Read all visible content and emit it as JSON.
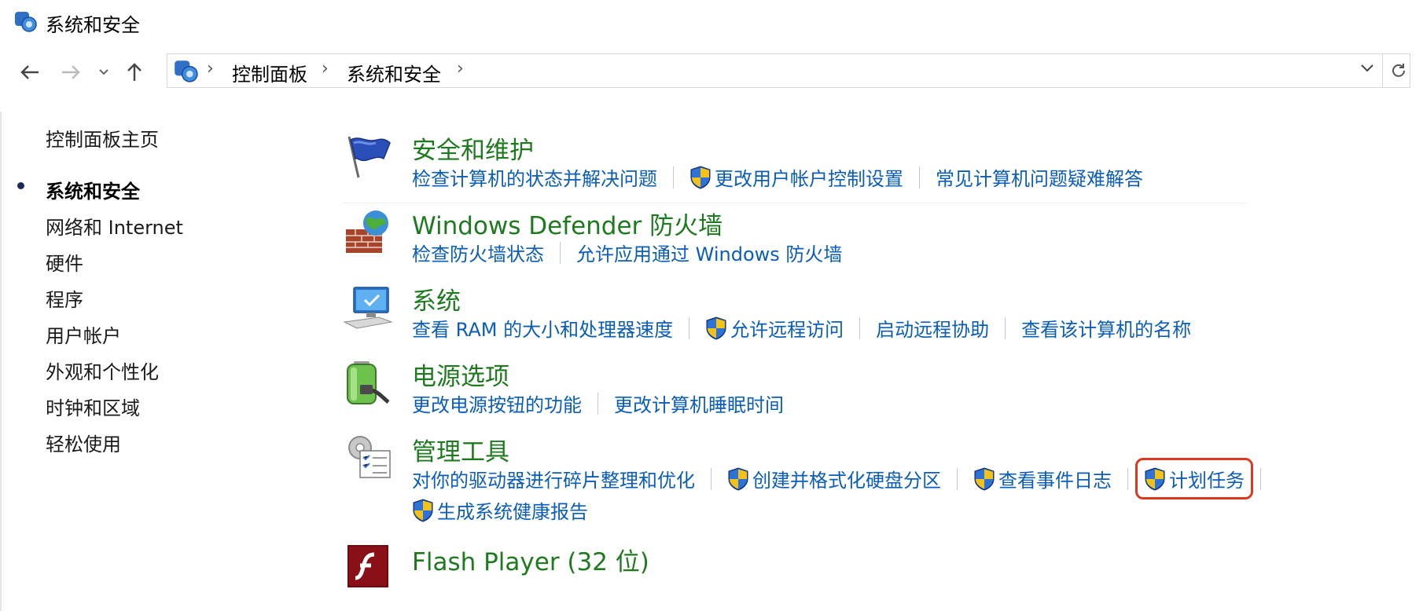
{
  "window": {
    "title": "系统和安全"
  },
  "address_bar": {
    "breadcrumbs": [
      "控制面板",
      "系统和安全"
    ]
  },
  "left_nav": {
    "items": [
      {
        "label": "控制面板主页",
        "active": false
      },
      {
        "label": "系统和安全",
        "active": true
      },
      {
        "label": "网络和 Internet",
        "active": false
      },
      {
        "label": "硬件",
        "active": false
      },
      {
        "label": "程序",
        "active": false
      },
      {
        "label": "用户帐户",
        "active": false
      },
      {
        "label": "外观和个性化",
        "active": false
      },
      {
        "label": "时钟和区域",
        "active": false
      },
      {
        "label": "轻松使用",
        "active": false
      }
    ]
  },
  "categories": [
    {
      "title": "安全和维护",
      "icon": "flag-icon",
      "links": [
        {
          "label": "检查计算机的状态并解决问题",
          "shield": false
        },
        {
          "label": "更改用户帐户控制设置",
          "shield": true
        },
        {
          "label": "常见计算机问题疑难解答",
          "shield": false
        }
      ]
    },
    {
      "title": "Windows Defender 防火墙",
      "icon": "firewall-icon",
      "links": [
        {
          "label": "检查防火墙状态",
          "shield": false
        },
        {
          "label": "允许应用通过 Windows 防火墙",
          "shield": false
        }
      ]
    },
    {
      "title": "系统",
      "icon": "computer-icon",
      "links": [
        {
          "label": "查看 RAM 的大小和处理器速度",
          "shield": false
        },
        {
          "label": "允许远程访问",
          "shield": true
        },
        {
          "label": "启动远程协助",
          "shield": false
        },
        {
          "label": "查看该计算机的名称",
          "shield": false
        }
      ]
    },
    {
      "title": "电源选项",
      "icon": "battery-icon",
      "links": [
        {
          "label": "更改电源按钮的功能",
          "shield": false
        },
        {
          "label": "更改计算机睡眠时间",
          "shield": false
        }
      ]
    },
    {
      "title": "管理工具",
      "icon": "admin-tools-icon",
      "links": [
        {
          "label": "对你的驱动器进行碎片整理和优化",
          "shield": false
        },
        {
          "label": "创建并格式化硬盘分区",
          "shield": true
        },
        {
          "label": "查看事件日志",
          "shield": true
        },
        {
          "label": "计划任务",
          "shield": true,
          "highlighted": true
        },
        {
          "label": "生成系统健康报告",
          "shield": true
        }
      ]
    },
    {
      "title": "Flash Player (32 位)",
      "icon": "flash-player-icon",
      "links": []
    }
  ],
  "colors": {
    "link": "#0b5eb8",
    "category_title": "#1e7a1e",
    "highlight_box": "#d93a22"
  }
}
